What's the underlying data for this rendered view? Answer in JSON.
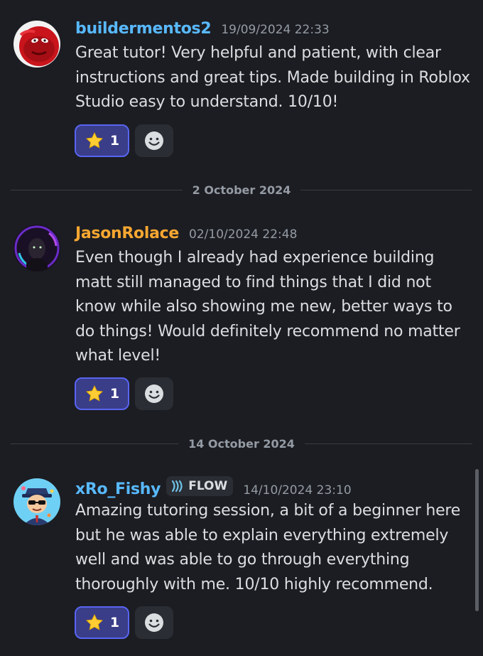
{
  "colors": {
    "background": "#1c1d22",
    "username_blue": "#58b9ff",
    "username_orange": "#f7a731",
    "reaction_bg": "#3a3d88",
    "reaction_border": "#5865f2"
  },
  "messages": [
    {
      "username": "buildermentos2",
      "timestamp": "19/09/2024 22:33",
      "avatar": "red-creature-avatar",
      "content": "Great tutor! Very helpful and patient, with clear instructions and great tips. Made building in Roblox Studio easy to understand. 10/10!",
      "reaction": {
        "emoji": "star-icon",
        "count": "1"
      }
    },
    {
      "username": "JasonRolace",
      "timestamp": "02/10/2024 22:48",
      "avatar": "dark-hooded-figure-avatar",
      "content": "Even though I already had experience building matt still managed to find things that I did not know while also showing me new, better ways to do things! Would definitely recommend no matter what level!",
      "reaction": {
        "emoji": "star-icon",
        "count": "1"
      }
    },
    {
      "username": "xRo_Fishy",
      "tag": "FLOW",
      "timestamp": "14/10/2024 23:10",
      "avatar": "cartoon-character-avatar",
      "content": "Amazing tutoring session, a bit of a beginner here but he was able to explain everything extremely well and was able to go through everything thoroughly with me. 10/10 highly recommend.",
      "reaction": {
        "emoji": "star-icon",
        "count": "1"
      }
    }
  ],
  "dividers": [
    {
      "date": "2 October 2024"
    },
    {
      "date": "14 October 2024"
    }
  ]
}
